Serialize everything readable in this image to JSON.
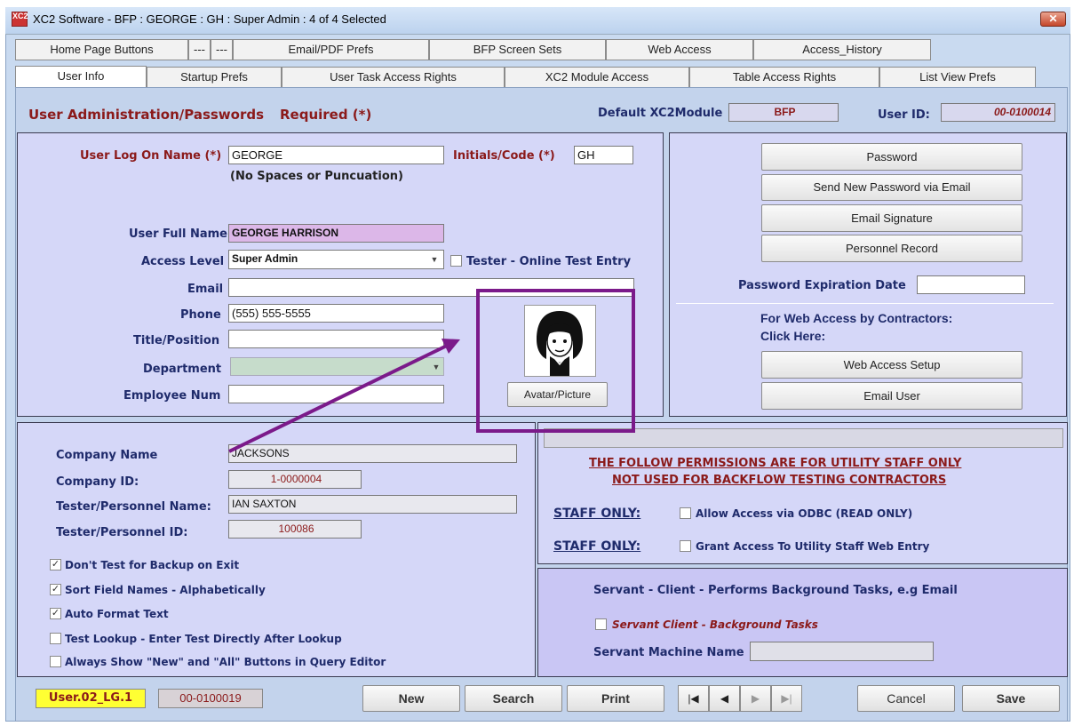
{
  "window": {
    "title": "XC2 Software - BFP : GEORGE  :  GH  :  Super Admin : 4 of 4 Selected",
    "close": "✕",
    "icon_text": "XC2"
  },
  "tabs_row1": [
    {
      "label": "Home Page Buttons"
    },
    {
      "label": "---"
    },
    {
      "label": "---"
    },
    {
      "label": "Email/PDF Prefs"
    },
    {
      "label": "BFP Screen Sets"
    },
    {
      "label": "Web Access"
    },
    {
      "label": "Access_History"
    }
  ],
  "tabs_row2": [
    {
      "label": "User Info"
    },
    {
      "label": "Startup Prefs"
    },
    {
      "label": "User Task Access Rights"
    },
    {
      "label": "XC2 Module Access"
    },
    {
      "label": "Table Access Rights"
    },
    {
      "label": "List View Prefs"
    }
  ],
  "header": {
    "title": "User Administration/Passwords",
    "required": "Required (*)",
    "default_module_label": "Default XC2Module",
    "default_module_value": "BFP",
    "user_id_label": "User ID:",
    "user_id_value": "00-0100014"
  },
  "user": {
    "logon_label": "User Log On Name (*)",
    "logon_value": "GEORGE",
    "logon_hint": "(No Spaces or Puncuation)",
    "initials_label": "Initials/Code (*)",
    "initials_value": "GH",
    "fullname_label": "User Full Name",
    "fullname_value": "GEORGE HARRISON",
    "access_label": "Access Level",
    "access_value": "Super Admin",
    "tester_label": "Tester - Online Test Entry",
    "email_label": "Email",
    "email_value": "",
    "phone_label": "Phone",
    "phone_value": "(555) 555-5555",
    "title_label": "Title/Position",
    "title_value": "",
    "dept_label": "Department",
    "dept_value": "",
    "empnum_label": "Employee Num",
    "empnum_value": "",
    "avatar_button": "Avatar/Picture"
  },
  "right_panel": {
    "password": "Password",
    "send_password": "Send New Password via Email",
    "email_signature": "Email Signature",
    "personnel_record": "Personnel Record",
    "pwd_exp_label": "Password Expiration Date",
    "pwd_exp_value": "",
    "web_access_line1": "For Web Access by Contractors:",
    "web_access_line2": "Click Here:",
    "web_access_setup": "Web Access Setup",
    "email_user": "Email User"
  },
  "company": {
    "name_label": "Company Name",
    "name_value": "JACKSONS",
    "id_label": "Company  ID:",
    "id_value": "1-0000004",
    "tester_name_label": "Tester/Personnel Name:",
    "tester_name_value": "IAN SAXTON",
    "tester_id_label": "Tester/Personnel  ID:",
    "tester_id_value": "100086"
  },
  "options": [
    {
      "label": "Don't Test for Backup on Exit",
      "checked": true
    },
    {
      "label": "Sort Field Names - Alphabetically",
      "checked": true
    },
    {
      "label": "Auto Format Text",
      "checked": true
    },
    {
      "label": "Test Lookup - Enter Test Directly After Lookup",
      "checked": false
    },
    {
      "label": "Always Show \"New\" and \"All\" Buttons in Query Editor",
      "checked": false
    }
  ],
  "staff": {
    "notice_line1": "THE FOLLOW PERMISSIONS ARE FOR UTILITY STAFF ONLY",
    "notice_line2": "NOT USED FOR BACKFLOW TESTING CONTRACTORS",
    "staff_only_1": "STAFF ONLY:",
    "odbc_label": "Allow Access via ODBC (READ ONLY)",
    "staff_only_2": "STAFF ONLY:",
    "web_entry_label": "Grant Access To Utility Staff Web Entry"
  },
  "servant": {
    "title": "Servant  -  Client - Performs Background Tasks, e.g Email",
    "client_label": "Servant Client - Background Tasks",
    "machine_label": "Servant Machine Name",
    "machine_value": ""
  },
  "footer": {
    "form_id": "User.02_LG.1",
    "record_id": "00-0100019",
    "new": "New",
    "search": "Search",
    "print": "Print",
    "first": "|◀",
    "prev": "◀",
    "next": "▶",
    "last": "▶|",
    "cancel": "Cancel",
    "save": "Save"
  },
  "colors": {
    "accent_purple": "#7b1a8a",
    "label_blue": "#1f2b6b",
    "label_red": "#8b1a1a",
    "form_id_bg": "#ffff33"
  },
  "icons": [
    "app-logo-icon",
    "close-icon",
    "dropdown-arrow-icon",
    "avatar-image",
    "arrow-annotation"
  ]
}
